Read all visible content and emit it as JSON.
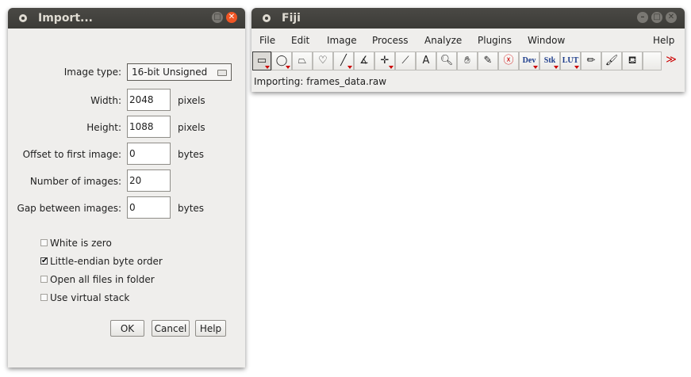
{
  "import_dialog": {
    "title": "Import...",
    "image_type": {
      "label": "Image type:",
      "value": "16-bit Unsigned"
    },
    "width": {
      "label": "Width:",
      "value": "2048",
      "unit": "pixels"
    },
    "height": {
      "label": "Height:",
      "value": "1088",
      "unit": "pixels"
    },
    "offset": {
      "label": "Offset to first image:",
      "value": "0",
      "unit": "bytes"
    },
    "num_images": {
      "label": "Number of images:",
      "value": "20"
    },
    "gap": {
      "label": "Gap between images:",
      "value": "0",
      "unit": "bytes"
    },
    "checkboxes": [
      {
        "label": "White is zero",
        "checked": false
      },
      {
        "label": "Little-endian byte order",
        "checked": true
      },
      {
        "label": "Open all files in folder",
        "checked": false
      },
      {
        "label": "Use virtual stack",
        "checked": false
      }
    ],
    "buttons": {
      "ok": "OK",
      "cancel": "Cancel",
      "help": "Help"
    }
  },
  "fiji": {
    "title": "Fiji",
    "menu": [
      "File",
      "Edit",
      "Image",
      "Process",
      "Analyze",
      "Plugins",
      "Window",
      "Help"
    ],
    "tools": [
      {
        "name": "rectangle-tool-icon",
        "glyph": "▭",
        "active": true,
        "menu": true
      },
      {
        "name": "oval-tool-icon",
        "glyph": "◯",
        "menu": true
      },
      {
        "name": "polygon-tool-icon",
        "glyph": "⏢",
        "menu": false
      },
      {
        "name": "freehand-tool-icon",
        "glyph": "♡",
        "menu": false
      },
      {
        "name": "line-tool-icon",
        "glyph": "╱",
        "menu": true
      },
      {
        "name": "angle-tool-icon",
        "glyph": "∡",
        "menu": false
      },
      {
        "name": "point-tool-icon",
        "glyph": "✛",
        "menu": true
      },
      {
        "name": "wand-tool-icon",
        "glyph": "⟋",
        "menu": false
      },
      {
        "name": "text-tool-icon",
        "glyph": "A",
        "menu": false
      },
      {
        "name": "magnifier-tool-icon",
        "glyph": "🔍︎",
        "menu": false
      },
      {
        "name": "hand-tool-icon",
        "glyph": "✋︎",
        "menu": false
      },
      {
        "name": "color-picker-icon",
        "glyph": "✎",
        "menu": false
      },
      {
        "name": "clear-icon",
        "glyph": "ⓧ",
        "menu": false
      },
      {
        "name": "dev-menu-icon",
        "glyph": "Dev",
        "menu": true,
        "text": true
      },
      {
        "name": "stk-menu-icon",
        "glyph": "Stk",
        "menu": true,
        "text": true
      },
      {
        "name": "lut-menu-icon",
        "glyph": "LUT",
        "menu": true,
        "text": true
      },
      {
        "name": "pencil-tool-icon",
        "glyph": "✏︎",
        "menu": false
      },
      {
        "name": "brush-tool-icon",
        "glyph": "🖌︎",
        "menu": false
      },
      {
        "name": "flood-fill-icon",
        "glyph": "⛾",
        "menu": false
      },
      {
        "name": "empty-slot",
        "glyph": "",
        "menu": false
      },
      {
        "name": "more-tools-icon",
        "glyph": "≫",
        "menu": false
      }
    ],
    "status": "Importing: frames_data.raw"
  }
}
